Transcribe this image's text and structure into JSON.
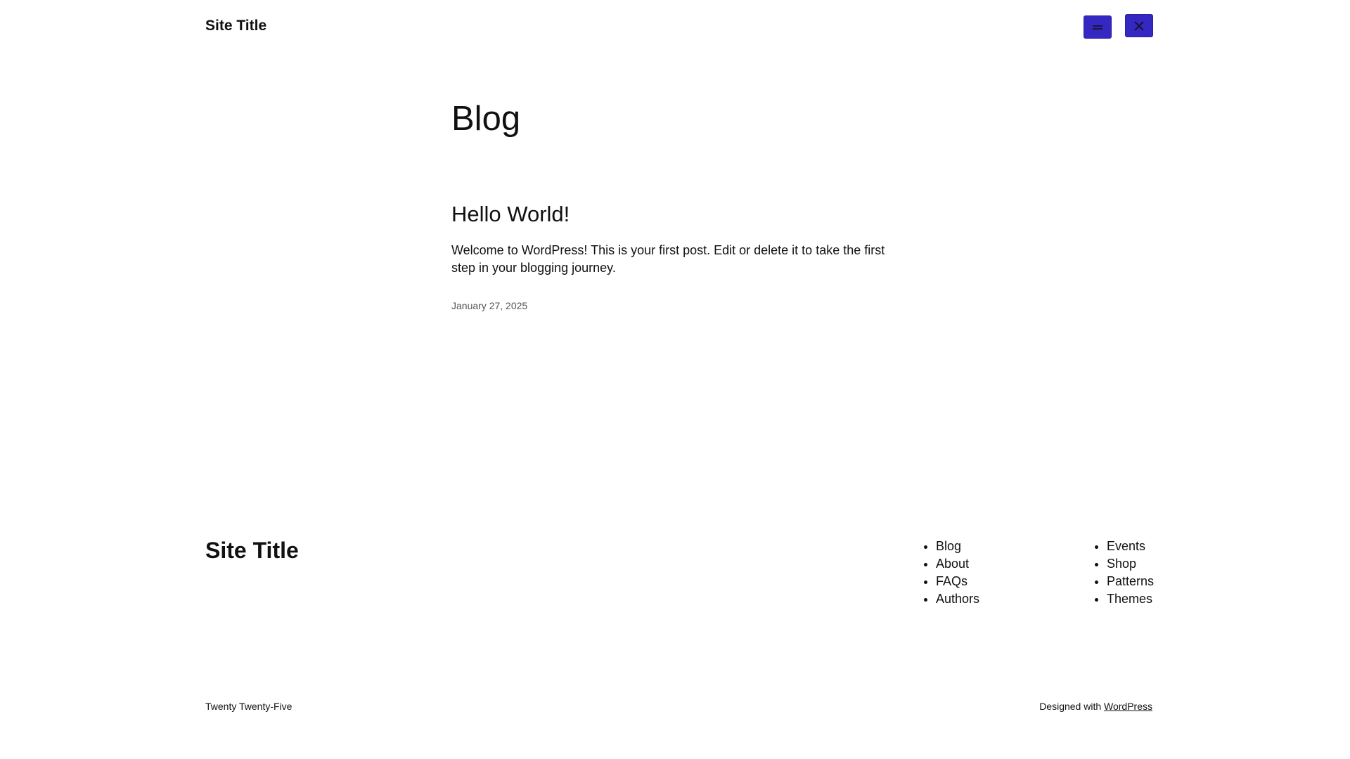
{
  "header": {
    "site_title": "Site Title",
    "buttons": [
      {
        "icon": "menu-icon"
      },
      {
        "icon": "close-icon"
      }
    ]
  },
  "main": {
    "heading": "Blog",
    "posts": [
      {
        "title": "Hello World!",
        "excerpt": "Welcome to WordPress! This is your first post. Edit or delete it to take the first step in your blogging journey.",
        "date": "January 27, 2025"
      }
    ]
  },
  "footer": {
    "site_title": "Site Title",
    "nav_col1": [
      "Blog",
      "About",
      "FAQs",
      "Authors"
    ],
    "nav_col2": [
      "Events",
      "Shop",
      "Patterns",
      "Themes"
    ],
    "theme_name": "Twenty Twenty-Five",
    "credit_prefix": "Designed with",
    "credit_link": "WordPress"
  },
  "colors": {
    "accent": "#3527c2",
    "text": "#111111",
    "muted": "#555555",
    "background": "#ffffff"
  }
}
